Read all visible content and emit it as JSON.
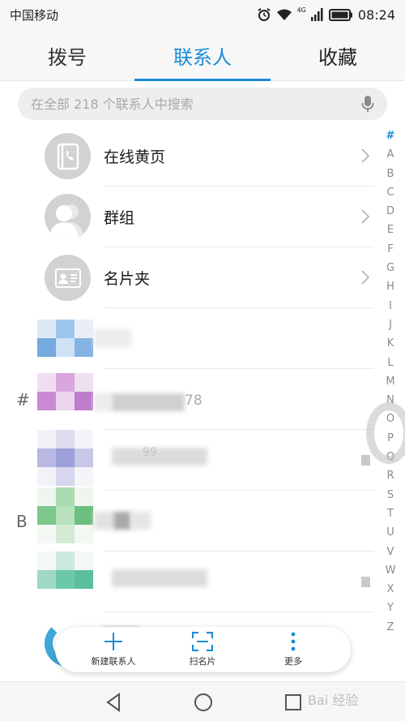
{
  "status_bar": {
    "carrier": "中国移动",
    "network": "4G",
    "time": "08:24",
    "icons": [
      "alarm-icon",
      "wifi-icon",
      "signal-icon",
      "battery-icon"
    ]
  },
  "tabs": [
    {
      "label": "拨号",
      "active": false
    },
    {
      "label": "联系人",
      "active": true
    },
    {
      "label": "收藏",
      "active": false
    }
  ],
  "search": {
    "placeholder": "在全部 218 个联系人中搜索",
    "icon": "microphone-icon"
  },
  "list": {
    "top_rows": [
      {
        "label": "在线黄页",
        "icon": "phone-book-icon"
      },
      {
        "label": "群组",
        "icon": "group-icon"
      },
      {
        "label": "名片夹",
        "icon": "business-card-icon"
      }
    ],
    "section_letters": [
      "#",
      "B"
    ],
    "blurred_fragments": [
      "78",
      "99"
    ]
  },
  "alphabet_index": [
    "#",
    "A",
    "B",
    "C",
    "D",
    "E",
    "F",
    "G",
    "H",
    "I",
    "J",
    "K",
    "L",
    "M",
    "N",
    "O",
    "P",
    "Q",
    "R",
    "S",
    "T",
    "U",
    "V",
    "W",
    "X",
    "Y",
    "Z"
  ],
  "action_bar": {
    "new_contact": "新建联系人",
    "scan_card": "扫名片",
    "more": "更多"
  },
  "watermark": "Bai 经验",
  "colors": {
    "accent": "#1a8cd8",
    "avatar_gray": "#d2d2d2"
  }
}
